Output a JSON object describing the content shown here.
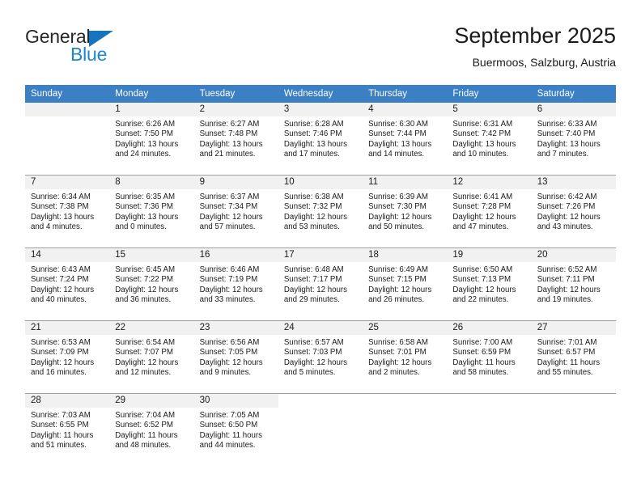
{
  "logo": {
    "word_top": "General",
    "word_bottom": "Blue",
    "triangle_color": "#1574bb",
    "text_color": "#25282a",
    "blue_color": "#1d86d0"
  },
  "header": {
    "title": "September 2025",
    "subtitle": "Buermoos, Salzburg, Austria"
  },
  "theme": {
    "header_bg": "#3b7fc4",
    "header_text": "#ffffff",
    "daynum_bg": "#f1f1f1",
    "cell_bg": "#ffffff",
    "rule_color": "#9f9f9f"
  },
  "columns": [
    "Sunday",
    "Monday",
    "Tuesday",
    "Wednesday",
    "Thursday",
    "Friday",
    "Saturday"
  ],
  "weeks": [
    [
      {
        "day": "",
        "lines": []
      },
      {
        "day": "1",
        "lines": [
          "Sunrise: 6:26 AM",
          "Sunset: 7:50 PM",
          "Daylight: 13 hours",
          "and 24 minutes."
        ]
      },
      {
        "day": "2",
        "lines": [
          "Sunrise: 6:27 AM",
          "Sunset: 7:48 PM",
          "Daylight: 13 hours",
          "and 21 minutes."
        ]
      },
      {
        "day": "3",
        "lines": [
          "Sunrise: 6:28 AM",
          "Sunset: 7:46 PM",
          "Daylight: 13 hours",
          "and 17 minutes."
        ]
      },
      {
        "day": "4",
        "lines": [
          "Sunrise: 6:30 AM",
          "Sunset: 7:44 PM",
          "Daylight: 13 hours",
          "and 14 minutes."
        ]
      },
      {
        "day": "5",
        "lines": [
          "Sunrise: 6:31 AM",
          "Sunset: 7:42 PM",
          "Daylight: 13 hours",
          "and 10 minutes."
        ]
      },
      {
        "day": "6",
        "lines": [
          "Sunrise: 6:33 AM",
          "Sunset: 7:40 PM",
          "Daylight: 13 hours",
          "and 7 minutes."
        ]
      }
    ],
    [
      {
        "day": "7",
        "lines": [
          "Sunrise: 6:34 AM",
          "Sunset: 7:38 PM",
          "Daylight: 13 hours",
          "and 4 minutes."
        ]
      },
      {
        "day": "8",
        "lines": [
          "Sunrise: 6:35 AM",
          "Sunset: 7:36 PM",
          "Daylight: 13 hours",
          "and 0 minutes."
        ]
      },
      {
        "day": "9",
        "lines": [
          "Sunrise: 6:37 AM",
          "Sunset: 7:34 PM",
          "Daylight: 12 hours",
          "and 57 minutes."
        ]
      },
      {
        "day": "10",
        "lines": [
          "Sunrise: 6:38 AM",
          "Sunset: 7:32 PM",
          "Daylight: 12 hours",
          "and 53 minutes."
        ]
      },
      {
        "day": "11",
        "lines": [
          "Sunrise: 6:39 AM",
          "Sunset: 7:30 PM",
          "Daylight: 12 hours",
          "and 50 minutes."
        ]
      },
      {
        "day": "12",
        "lines": [
          "Sunrise: 6:41 AM",
          "Sunset: 7:28 PM",
          "Daylight: 12 hours",
          "and 47 minutes."
        ]
      },
      {
        "day": "13",
        "lines": [
          "Sunrise: 6:42 AM",
          "Sunset: 7:26 PM",
          "Daylight: 12 hours",
          "and 43 minutes."
        ]
      }
    ],
    [
      {
        "day": "14",
        "lines": [
          "Sunrise: 6:43 AM",
          "Sunset: 7:24 PM",
          "Daylight: 12 hours",
          "and 40 minutes."
        ]
      },
      {
        "day": "15",
        "lines": [
          "Sunrise: 6:45 AM",
          "Sunset: 7:22 PM",
          "Daylight: 12 hours",
          "and 36 minutes."
        ]
      },
      {
        "day": "16",
        "lines": [
          "Sunrise: 6:46 AM",
          "Sunset: 7:19 PM",
          "Daylight: 12 hours",
          "and 33 minutes."
        ]
      },
      {
        "day": "17",
        "lines": [
          "Sunrise: 6:48 AM",
          "Sunset: 7:17 PM",
          "Daylight: 12 hours",
          "and 29 minutes."
        ]
      },
      {
        "day": "18",
        "lines": [
          "Sunrise: 6:49 AM",
          "Sunset: 7:15 PM",
          "Daylight: 12 hours",
          "and 26 minutes."
        ]
      },
      {
        "day": "19",
        "lines": [
          "Sunrise: 6:50 AM",
          "Sunset: 7:13 PM",
          "Daylight: 12 hours",
          "and 22 minutes."
        ]
      },
      {
        "day": "20",
        "lines": [
          "Sunrise: 6:52 AM",
          "Sunset: 7:11 PM",
          "Daylight: 12 hours",
          "and 19 minutes."
        ]
      }
    ],
    [
      {
        "day": "21",
        "lines": [
          "Sunrise: 6:53 AM",
          "Sunset: 7:09 PM",
          "Daylight: 12 hours",
          "and 16 minutes."
        ]
      },
      {
        "day": "22",
        "lines": [
          "Sunrise: 6:54 AM",
          "Sunset: 7:07 PM",
          "Daylight: 12 hours",
          "and 12 minutes."
        ]
      },
      {
        "day": "23",
        "lines": [
          "Sunrise: 6:56 AM",
          "Sunset: 7:05 PM",
          "Daylight: 12 hours",
          "and 9 minutes."
        ]
      },
      {
        "day": "24",
        "lines": [
          "Sunrise: 6:57 AM",
          "Sunset: 7:03 PM",
          "Daylight: 12 hours",
          "and 5 minutes."
        ]
      },
      {
        "day": "25",
        "lines": [
          "Sunrise: 6:58 AM",
          "Sunset: 7:01 PM",
          "Daylight: 12 hours",
          "and 2 minutes."
        ]
      },
      {
        "day": "26",
        "lines": [
          "Sunrise: 7:00 AM",
          "Sunset: 6:59 PM",
          "Daylight: 11 hours",
          "and 58 minutes."
        ]
      },
      {
        "day": "27",
        "lines": [
          "Sunrise: 7:01 AM",
          "Sunset: 6:57 PM",
          "Daylight: 11 hours",
          "and 55 minutes."
        ]
      }
    ],
    [
      {
        "day": "28",
        "lines": [
          "Sunrise: 7:03 AM",
          "Sunset: 6:55 PM",
          "Daylight: 11 hours",
          "and 51 minutes."
        ]
      },
      {
        "day": "29",
        "lines": [
          "Sunrise: 7:04 AM",
          "Sunset: 6:52 PM",
          "Daylight: 11 hours",
          "and 48 minutes."
        ]
      },
      {
        "day": "30",
        "lines": [
          "Sunrise: 7:05 AM",
          "Sunset: 6:50 PM",
          "Daylight: 11 hours",
          "and 44 minutes."
        ]
      },
      {
        "day": "",
        "lines": []
      },
      {
        "day": "",
        "lines": []
      },
      {
        "day": "",
        "lines": []
      },
      {
        "day": "",
        "lines": []
      }
    ]
  ]
}
